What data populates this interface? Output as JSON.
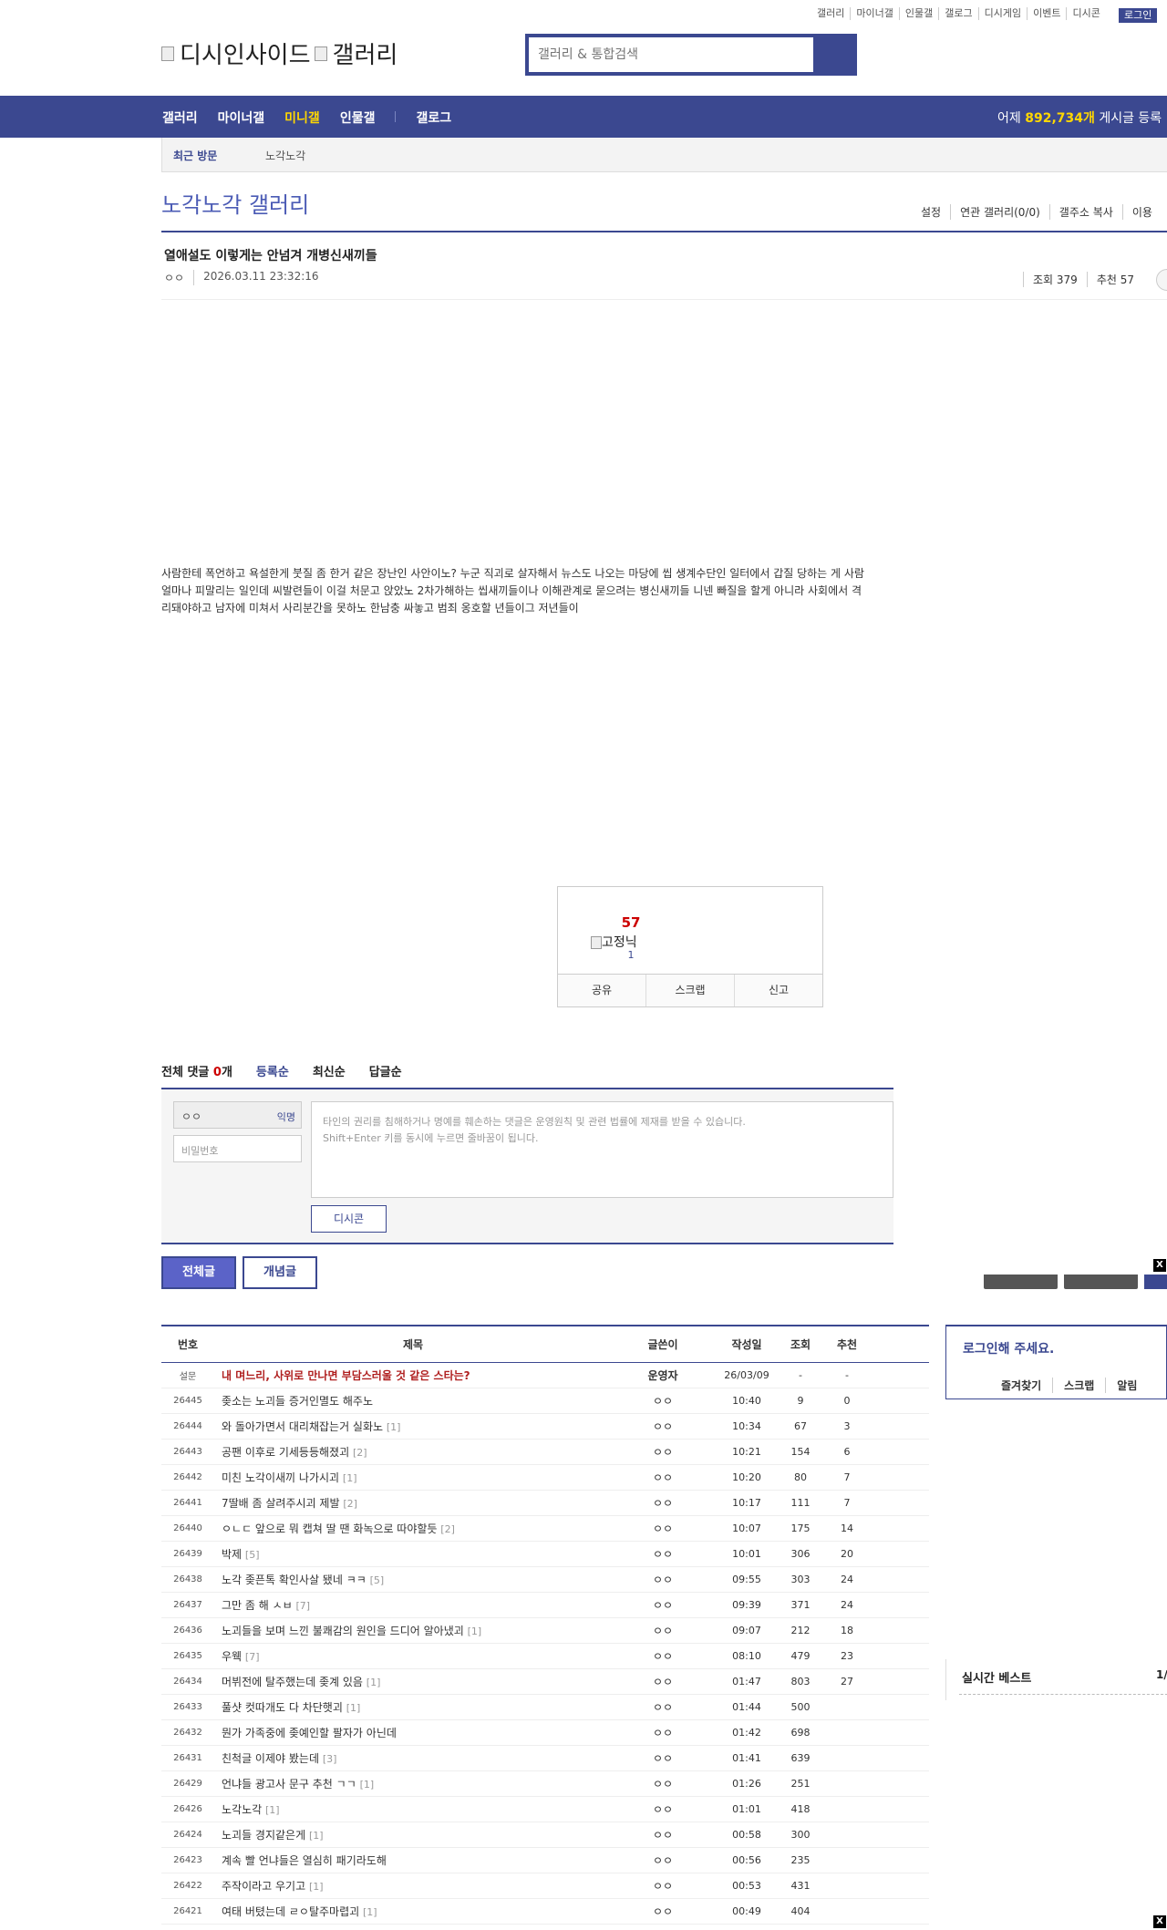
{
  "util_links": [
    "갤러리",
    "마이너갤",
    "인물갤",
    "갤로그",
    "디시게임",
    "이벤트",
    "디시콘"
  ],
  "login_label": "로그인",
  "logo": {
    "left": "디시인사이드",
    "right": "갤러리"
  },
  "search": {
    "placeholder": "갤러리 & 통합검색"
  },
  "gnb": {
    "items": [
      "갤러리",
      "마이너갤",
      "미니갤",
      "인물갤",
      "갤로그"
    ],
    "stat_prefix": "어제 ",
    "stat_value": "892,734개",
    "stat_suffix": " 게시글 등록"
  },
  "recent": {
    "label": "최근 방문",
    "item": "노각노각"
  },
  "gallery": {
    "title": "노각노각 갤러리",
    "tools": [
      "설정",
      "연관 갤러리(0/0)",
      "갤주소 복사",
      "이용"
    ]
  },
  "post": {
    "title": "열애설도 이렇게는 안넘겨 개병신새끼들",
    "author": "ㅇㅇ",
    "date": "2026.03.11 23:32:16",
    "views": "조회 379",
    "recommends": "추천 57",
    "body_lines": [
      "사람한테 폭언하고 욕설한게 붓질 좀 한거 같은 장난인 사안이노? 누군 직괴로 살자해서 뉴스도 나오는 마당에 씹 생계수단인 일터에서 갑질 당하는 게 사람",
      "얼마나 피말리는 일인데 씨발련들이 이걸 처문고 앉았노 2차가해하는 씹새끼들이나 이해관계로 묻으려는 병신새끼들 니넨 빠질을 할게 아니라 사회에서 격",
      "리돼야하고 남자에 미쳐서 사리분간을 못하노 한남충 싸놓고 범죄 옹호할 년들이그 저년들이"
    ]
  },
  "recommend_box": {
    "count": "57",
    "image_alt": "고정닉",
    "fixed_count": "1",
    "actions": [
      "공유",
      "스크랩",
      "신고"
    ]
  },
  "comments": {
    "total_prefix": "전체 댓글 ",
    "total_count": "0",
    "total_suffix": "개",
    "tabs": [
      "등록순",
      "최신순",
      "답글순"
    ],
    "nick": "ㅇㅇ",
    "anon_label": "익명",
    "password_placeholder": "비밀번호",
    "textarea_line1": "타인의 권리를 침해하거나 명예를 훼손하는 댓글은 운영원칙 및 관련 법률에 제재를 받을 수 있습니다.",
    "textarea_line2": "Shift+Enter 키를 동시에 누르면 줄바꿈이 됩니다.",
    "dccon_label": "디시콘"
  },
  "list_buttons": {
    "all": "전체글",
    "concept": "개념글"
  },
  "close_label": "X",
  "list": {
    "headers": [
      "번호",
      "제목",
      "글쓴이",
      "작성일",
      "조회",
      "추천"
    ],
    "rows": [
      {
        "no": "설문",
        "title": "내 며느리, 사위로 만나면 부담스러울 것 같은 스타는?",
        "rc": "",
        "writer": "운영자",
        "date": "26/03/09",
        "views": "-",
        "rec": "-",
        "notice": true
      },
      {
        "no": "26445",
        "title": "좆소는 노괴들 증거인멸도 해주노",
        "rc": "",
        "writer": "ㅇㅇ",
        "date": "10:40",
        "views": "9",
        "rec": "0"
      },
      {
        "no": "26444",
        "title": "와 돌아가면서 대리채잡는거 실화노",
        "rc": "[1]",
        "writer": "ㅇㅇ",
        "date": "10:34",
        "views": "67",
        "rec": "3"
      },
      {
        "no": "26443",
        "title": "공팬 이후로 기세등등해졌괴",
        "rc": "[2]",
        "writer": "ㅇㅇ",
        "date": "10:21",
        "views": "154",
        "rec": "6"
      },
      {
        "no": "26442",
        "title": "미친 노각이새끼 나가시괴",
        "rc": "[1]",
        "writer": "ㅇㅇ",
        "date": "10:20",
        "views": "80",
        "rec": "7"
      },
      {
        "no": "26441",
        "title": "7딸배 좀 살려주시괴 제발",
        "rc": "[2]",
        "writer": "ㅇㅇ",
        "date": "10:17",
        "views": "111",
        "rec": "7"
      },
      {
        "no": "26440",
        "title": "ㅇㄴㄷ 앞으로 뭐 캡쳐 딸 땐 화녹으로 따야할듯",
        "rc": "[2]",
        "writer": "ㅇㅇ",
        "date": "10:07",
        "views": "175",
        "rec": "14"
      },
      {
        "no": "26439",
        "title": "박제",
        "rc": "[5]",
        "writer": "ㅇㅇ",
        "date": "10:01",
        "views": "306",
        "rec": "20"
      },
      {
        "no": "26438",
        "title": "노각 좆픈톡 확인사살 됐네 ㅋㅋ",
        "rc": "[5]",
        "writer": "ㅇㅇ",
        "date": "09:55",
        "views": "303",
        "rec": "24"
      },
      {
        "no": "26437",
        "title": "그만 좀 해 ㅅㅂ",
        "rc": "[7]",
        "writer": "ㅇㅇ",
        "date": "09:39",
        "views": "371",
        "rec": "24"
      },
      {
        "no": "26436",
        "title": "노괴들을 보며 느낀 불쾌감의 원인을 드디어 알아냈괴",
        "rc": "[1]",
        "writer": "ㅇㅇ",
        "date": "09:07",
        "views": "212",
        "rec": "18"
      },
      {
        "no": "26435",
        "title": "우웩",
        "rc": "[7]",
        "writer": "ㅇㅇ",
        "date": "08:10",
        "views": "479",
        "rec": "23"
      },
      {
        "no": "26434",
        "title": "머뷔전에 탈주했는데 좆계 있음",
        "rc": "[1]",
        "writer": "ㅇㅇ",
        "date": "01:47",
        "views": "803",
        "rec": "27"
      },
      {
        "no": "26433",
        "title": "풀샷 컷따개도 다 차단햇괴",
        "rc": "[1]",
        "writer": "ㅇㅇ",
        "date": "01:44",
        "views": "500",
        "rec": ""
      },
      {
        "no": "26432",
        "title": "뭔가 가족중에 좆예인할 팔자가 아닌데",
        "rc": "",
        "writer": "ㅇㅇ",
        "date": "01:42",
        "views": "698",
        "rec": ""
      },
      {
        "no": "26431",
        "title": "친척글 이제야 봤는데",
        "rc": "[3]",
        "writer": "ㅇㅇ",
        "date": "01:41",
        "views": "639",
        "rec": ""
      },
      {
        "no": "26429",
        "title": "언냐들 광고사 문구 추천 ㄱㄱ",
        "rc": "[1]",
        "writer": "ㅇㅇ",
        "date": "01:26",
        "views": "251",
        "rec": ""
      },
      {
        "no": "26426",
        "title": "노각노각",
        "rc": "[1]",
        "writer": "ㅇㅇ",
        "date": "01:01",
        "views": "418",
        "rec": ""
      },
      {
        "no": "26424",
        "title": "노괴들 경지같은게",
        "rc": "[1]",
        "writer": "ㅇㅇ",
        "date": "00:58",
        "views": "300",
        "rec": ""
      },
      {
        "no": "26423",
        "title": "계속 빨 언냐들은 열심히 패기라도해",
        "rc": "",
        "writer": "ㅇㅇ",
        "date": "00:56",
        "views": "235",
        "rec": ""
      },
      {
        "no": "26422",
        "title": "주작이라고 우기고",
        "rc": "[1]",
        "writer": "ㅇㅇ",
        "date": "00:53",
        "views": "431",
        "rec": ""
      },
      {
        "no": "26421",
        "title": "여태 버텼는데 ㄹㅇ탈주마렵괴",
        "rc": "[1]",
        "writer": "ㅇㅇ",
        "date": "00:49",
        "views": "404",
        "rec": ""
      }
    ]
  },
  "side": {
    "login_title": "로그인해 주세요.",
    "login_links": [
      "즐겨찾기",
      "스크랩",
      "알림"
    ],
    "best_title": "실시간 베스트",
    "best_page": "1/"
  }
}
